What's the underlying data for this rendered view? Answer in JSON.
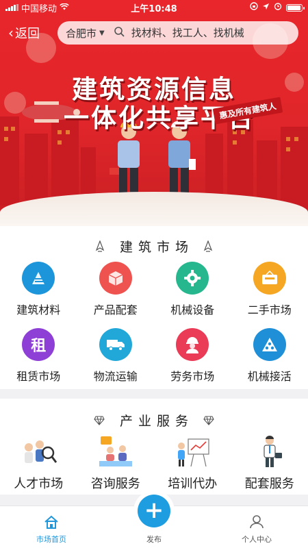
{
  "status_bar": {
    "carrier": "中国移动",
    "time": "上午10:48",
    "battery_level": 0.95
  },
  "nav": {
    "back_label": "返回",
    "city": "合肥市",
    "search_placeholder": "找材料、找工人、找机械"
  },
  "banner": {
    "title_line1": "建筑资源信息",
    "title_line2": "一体化共享平台",
    "ribbon": "惠及所有建筑人"
  },
  "market": {
    "title": "建筑市场",
    "items": [
      {
        "label": "建筑材料",
        "icon": "materials-icon",
        "color": "#1c95da"
      },
      {
        "label": "产品配套",
        "icon": "box-icon",
        "color": "#ef5350"
      },
      {
        "label": "机械设备",
        "icon": "gear-icon",
        "color": "#26b78f"
      },
      {
        "label": "二手市场",
        "icon": "shop-icon",
        "color": "#f5a623"
      },
      {
        "label": "租赁市场",
        "icon": "rent-icon",
        "color": "#8e3fd6"
      },
      {
        "label": "物流运输",
        "icon": "truck-icon",
        "color": "#22a8d8"
      },
      {
        "label": "劳务市场",
        "icon": "worker-icon",
        "color": "#ea3b57"
      },
      {
        "label": "机械接活",
        "icon": "machine-icon",
        "color": "#1f8fd8"
      }
    ]
  },
  "services": {
    "title": "产业服务",
    "items": [
      {
        "label": "人才市场",
        "icon": "talent-icon"
      },
      {
        "label": "咨询服务",
        "icon": "consult-icon"
      },
      {
        "label": "培训代办",
        "icon": "training-icon"
      },
      {
        "label": "配套服务",
        "icon": "support-icon"
      }
    ]
  },
  "tabbar": {
    "home": "市场首页",
    "publish": "发布",
    "user": "个人中心",
    "active_color": "#2196d9"
  }
}
